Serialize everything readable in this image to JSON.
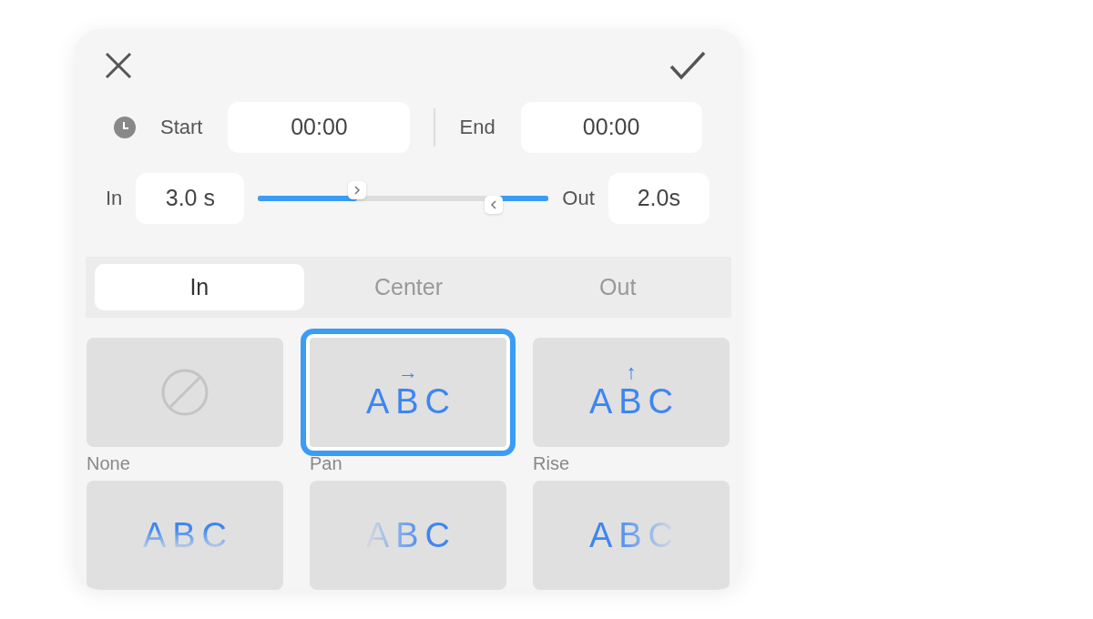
{
  "time": {
    "start_label": "Start",
    "start_value": "00:00",
    "end_label": "End",
    "end_value": "00:00"
  },
  "duration": {
    "in_label": "In",
    "in_value": "3.0 s",
    "out_label": "Out",
    "out_value": "2.0s",
    "in_handle": {
      "level": 0.34
    },
    "out_handle": {
      "level": 0.81
    }
  },
  "tabs": [
    {
      "label": "In",
      "selected": true
    },
    {
      "label": "Center",
      "selected": false
    },
    {
      "label": "Out",
      "selected": false
    }
  ],
  "effects": [
    {
      "kind": "none",
      "label": "None",
      "selected": false
    },
    {
      "kind": "pan",
      "sample": "ABC",
      "arrow": "→",
      "label": "Pan",
      "selected": true
    },
    {
      "kind": "rise",
      "sample": "ABC",
      "arrow": "↑",
      "label": "Rise",
      "selected": false
    },
    {
      "kind": "fade-up",
      "sample": "ABC",
      "selected": false
    },
    {
      "kind": "fade-left",
      "sample": "ABC",
      "selected": false
    },
    {
      "kind": "fade-right",
      "sample": "ABC",
      "selected": false
    }
  ]
}
